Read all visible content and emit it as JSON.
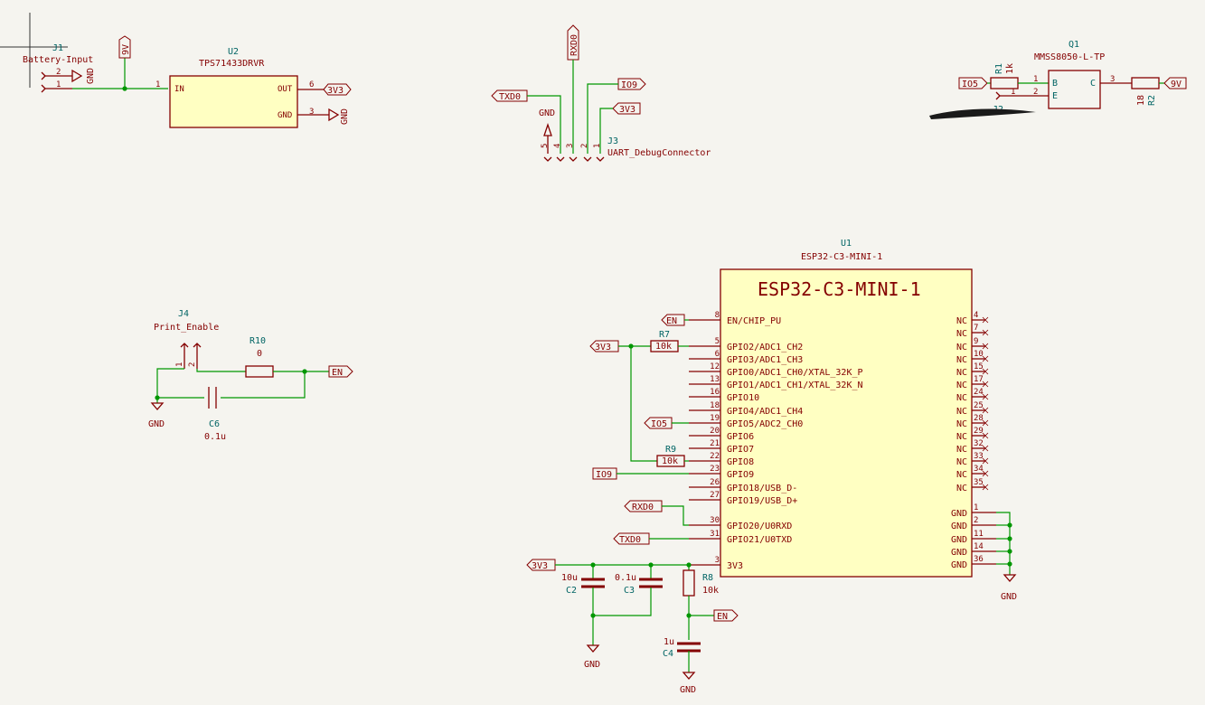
{
  "j1": {
    "ref": "J1",
    "value": "Battery-Input",
    "pins": [
      "2",
      "1"
    ]
  },
  "u2": {
    "ref": "U2",
    "value": "TPS71433DRVR",
    "pin_in_num": "1",
    "pin_in": "IN",
    "pin_out": "OUT",
    "pin_out_num": "6",
    "pin_gnd": "GND",
    "pin_gnd_num": "3"
  },
  "j3": {
    "ref": "J3",
    "value": "UART_DebugConnector",
    "pins": [
      "5",
      "4",
      "3",
      "2",
      "1"
    ]
  },
  "q1": {
    "ref": "Q1",
    "value": "MMSS8050-L-TP",
    "pin_b": "B",
    "pin_e": "E",
    "pin_c": "C",
    "pin_b_num": "1",
    "pin_e_num": "2",
    "pin_c_num": "3"
  },
  "r1": {
    "ref": "R1",
    "value": "1k"
  },
  "r2": {
    "ref": "R2",
    "value": "18"
  },
  "j2": {
    "ref": "J2",
    "pins": [
      "1",
      "2"
    ]
  },
  "j4": {
    "ref": "J4",
    "value": "Print_Enable",
    "pins": [
      "1",
      "2"
    ]
  },
  "r10": {
    "ref": "R10",
    "value": "0"
  },
  "c6": {
    "ref": "C6",
    "value": "0.1u"
  },
  "u1": {
    "ref": "U1",
    "value": "ESP32-C3-MINI-1",
    "title": "ESP32-C3-MINI-1"
  },
  "r7": {
    "ref": "R7",
    "value": "10k"
  },
  "r9": {
    "ref": "R9",
    "value": "10k"
  },
  "r8": {
    "ref": "R8",
    "value": "10k"
  },
  "c2": {
    "ref": "C2",
    "value": "10u"
  },
  "c3": {
    "ref": "C3",
    "value": "0.1u"
  },
  "c4": {
    "ref": "C4",
    "value": "1u"
  },
  "nets": {
    "v9": "9V",
    "v3": "3V3",
    "gnd": "GND",
    "en": "EN",
    "io5": "IO5",
    "io9": "IO9",
    "rxd0": "RXD0",
    "txd0": "TXD0"
  },
  "u1_left_pins": [
    {
      "num": "8",
      "name": "EN/CHIP_PU"
    },
    {
      "num": "5",
      "name": "GPIO2/ADC1_CH2"
    },
    {
      "num": "6",
      "name": "GPIO3/ADC1_CH3"
    },
    {
      "num": "12",
      "name": "GPIO0/ADC1_CH0/XTAL_32K_P"
    },
    {
      "num": "13",
      "name": "GPIO1/ADC1_CH1/XTAL_32K_N"
    },
    {
      "num": "16",
      "name": "GPIO10"
    },
    {
      "num": "18",
      "name": "GPIO4/ADC1_CH4"
    },
    {
      "num": "19",
      "name": "GPIO5/ADC2_CH0"
    },
    {
      "num": "20",
      "name": "GPIO6"
    },
    {
      "num": "21",
      "name": "GPIO7"
    },
    {
      "num": "22",
      "name": "GPIO8"
    },
    {
      "num": "23",
      "name": "GPIO9"
    },
    {
      "num": "26",
      "name": "GPIO18/USB_D-"
    },
    {
      "num": "27",
      "name": "GPIO19/USB_D+"
    },
    {
      "num": "30",
      "name": "GPIO20/U0RXD"
    },
    {
      "num": "31",
      "name": "GPIO21/U0TXD"
    },
    {
      "num": "3",
      "name": "3V3"
    }
  ],
  "u1_right_pins": [
    {
      "num": "4",
      "name": "NC"
    },
    {
      "num": "7",
      "name": "NC"
    },
    {
      "num": "9",
      "name": "NC"
    },
    {
      "num": "10",
      "name": "NC"
    },
    {
      "num": "15",
      "name": "NC"
    },
    {
      "num": "17",
      "name": "NC"
    },
    {
      "num": "24",
      "name": "NC"
    },
    {
      "num": "25",
      "name": "NC"
    },
    {
      "num": "28",
      "name": "NC"
    },
    {
      "num": "29",
      "name": "NC"
    },
    {
      "num": "32",
      "name": "NC"
    },
    {
      "num": "33",
      "name": "NC"
    },
    {
      "num": "34",
      "name": "NC"
    },
    {
      "num": "35",
      "name": "NC"
    },
    {
      "num": "1",
      "name": "GND"
    },
    {
      "num": "2",
      "name": "GND"
    },
    {
      "num": "11",
      "name": "GND"
    },
    {
      "num": "14",
      "name": "GND"
    },
    {
      "num": "36",
      "name": "GND"
    }
  ]
}
